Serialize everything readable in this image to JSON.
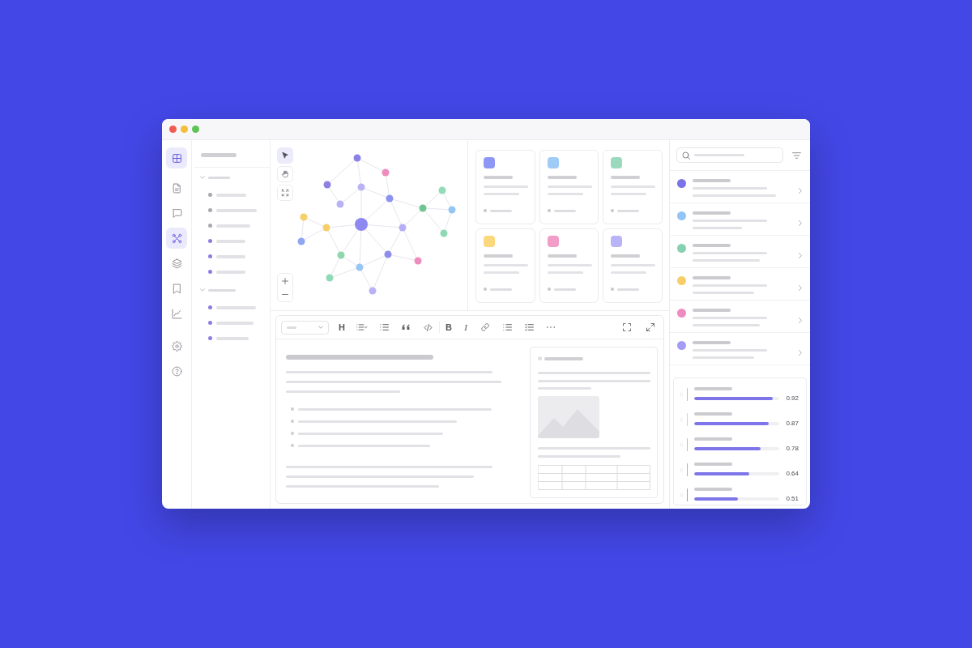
{
  "window": {
    "controls": [
      {
        "color": "#ee5c54"
      },
      {
        "color": "#f4bd3c"
      },
      {
        "color": "#5ec453"
      }
    ]
  },
  "nav": {
    "groups": [
      [
        {
          "kind": "grid",
          "selected": true
        }
      ],
      [
        {
          "kind": "document",
          "selected": false
        },
        {
          "kind": "chat",
          "selected": false
        },
        {
          "kind": "network",
          "selected": true
        },
        {
          "kind": "layers",
          "selected": false
        },
        {
          "kind": "bookmark",
          "selected": false
        },
        {
          "kind": "chart",
          "selected": false
        }
      ],
      [
        {
          "kind": "settings",
          "selected": false
        },
        {
          "kind": "help",
          "selected": false
        }
      ]
    ]
  },
  "tree": {
    "groups": [
      {
        "expanded": true,
        "children": [
          {
            "color": "#a9a9ae"
          },
          {
            "color": "#a9a9ae"
          },
          {
            "color": "#a9a9ae"
          },
          {
            "color": "#8a7fe3"
          },
          {
            "color": "#8a7fe3"
          },
          {
            "color": "#8a7fe3"
          }
        ]
      },
      {
        "expanded": true,
        "children": [
          {
            "color": "#8a7fe3"
          },
          {
            "color": "#8a7fe3"
          },
          {
            "color": "#8a7fe3"
          }
        ]
      }
    ]
  },
  "canvas": {
    "tools": [
      {
        "kind": "pointer",
        "selected": true
      },
      {
        "kind": "hand",
        "selected": false
      },
      {
        "kind": "fit",
        "selected": false
      }
    ],
    "zoom": [
      {
        "kind": "in"
      },
      {
        "kind": "out"
      }
    ]
  },
  "cards": [
    {
      "color": "#8e98f4"
    },
    {
      "color": "#a0cbf6"
    },
    {
      "color": "#9bd9bd"
    },
    {
      "color": "#fbd77d"
    },
    {
      "color": "#f29cc8"
    },
    {
      "color": "#b9b3f8"
    }
  ],
  "editor": {
    "toolbar": [
      [
        {
          "kind": "select"
        },
        {
          "kind": "heading",
          "label": "H"
        },
        {
          "kind": "list-style"
        },
        {
          "kind": "list"
        },
        {
          "kind": "quote"
        },
        {
          "kind": "code"
        }
      ],
      [
        {
          "kind": "bold",
          "label": "B"
        },
        {
          "kind": "italic",
          "label": "I"
        },
        {
          "kind": "link"
        },
        {
          "kind": "list"
        },
        {
          "kind": "checklist"
        },
        {
          "kind": "more"
        }
      ]
    ],
    "view_controls": [
      {
        "kind": "focus"
      },
      {
        "kind": "expand"
      }
    ]
  },
  "list": {
    "items": [
      {
        "color": "#7c73e8"
      },
      {
        "color": "#90c5f6"
      },
      {
        "color": "#86d2b0"
      },
      {
        "color": "#f7cd67"
      },
      {
        "color": "#ef8cbf"
      },
      {
        "color": "#a39bf4"
      }
    ]
  },
  "metrics": [
    {
      "color": "#8fd3b6",
      "level": 0.92,
      "reading": "0.92"
    },
    {
      "color": "#f5cf6a",
      "level": 0.87,
      "reading": "0.87"
    },
    {
      "color": "#9cc2f2",
      "level": 0.78,
      "reading": "0.78"
    },
    {
      "color": "#ee8fb5",
      "level": 0.64,
      "reading": "0.64"
    },
    {
      "color": "#9e93ee",
      "level": 0.51,
      "reading": "0.51"
    }
  ]
}
